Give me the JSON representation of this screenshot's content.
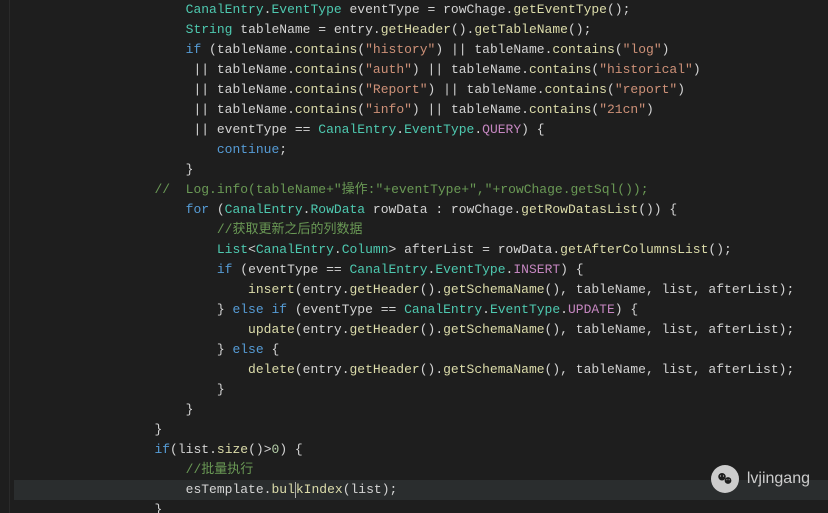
{
  "watermark": {
    "label": "lvjingang"
  },
  "code": {
    "lines": [
      {
        "indent": 3,
        "tokens": [
          {
            "t": "type",
            "v": "CanalEntry"
          },
          {
            "t": "punct",
            "v": "."
          },
          {
            "t": "type",
            "v": "EventType"
          },
          {
            "t": "punct",
            "v": " "
          },
          {
            "t": "var",
            "v": "eventType"
          },
          {
            "t": "punct",
            "v": " = "
          },
          {
            "t": "var",
            "v": "rowChage"
          },
          {
            "t": "punct",
            "v": "."
          },
          {
            "t": "method",
            "v": "getEventType"
          },
          {
            "t": "punct",
            "v": "();"
          }
        ]
      },
      {
        "indent": 3,
        "tokens": [
          {
            "t": "type",
            "v": "String"
          },
          {
            "t": "punct",
            "v": " "
          },
          {
            "t": "var",
            "v": "tableName"
          },
          {
            "t": "punct",
            "v": " = "
          },
          {
            "t": "var",
            "v": "entry"
          },
          {
            "t": "punct",
            "v": "."
          },
          {
            "t": "method",
            "v": "getHeader"
          },
          {
            "t": "punct",
            "v": "()."
          },
          {
            "t": "method",
            "v": "getTableName"
          },
          {
            "t": "punct",
            "v": "();"
          }
        ]
      },
      {
        "indent": 3,
        "tokens": [
          {
            "t": "kw",
            "v": "if"
          },
          {
            "t": "punct",
            "v": " ("
          },
          {
            "t": "var",
            "v": "tableName"
          },
          {
            "t": "punct",
            "v": "."
          },
          {
            "t": "method",
            "v": "contains"
          },
          {
            "t": "punct",
            "v": "("
          },
          {
            "t": "str",
            "v": "\"history\""
          },
          {
            "t": "punct",
            "v": ") || "
          },
          {
            "t": "var",
            "v": "tableName"
          },
          {
            "t": "punct",
            "v": "."
          },
          {
            "t": "method",
            "v": "contains"
          },
          {
            "t": "punct",
            "v": "("
          },
          {
            "t": "str",
            "v": "\"log\""
          },
          {
            "t": "punct",
            "v": ")"
          }
        ]
      },
      {
        "indent": 5,
        "tokens": [
          {
            "t": "punct",
            "v": "|| "
          },
          {
            "t": "var",
            "v": "tableName"
          },
          {
            "t": "punct",
            "v": "."
          },
          {
            "t": "method",
            "v": "contains"
          },
          {
            "t": "punct",
            "v": "("
          },
          {
            "t": "str",
            "v": "\"auth\""
          },
          {
            "t": "punct",
            "v": ") || "
          },
          {
            "t": "var",
            "v": "tableName"
          },
          {
            "t": "punct",
            "v": "."
          },
          {
            "t": "method",
            "v": "contains"
          },
          {
            "t": "punct",
            "v": "("
          },
          {
            "t": "str",
            "v": "\"historical\""
          },
          {
            "t": "punct",
            "v": ")"
          }
        ]
      },
      {
        "indent": 5,
        "tokens": [
          {
            "t": "punct",
            "v": "|| "
          },
          {
            "t": "var",
            "v": "tableName"
          },
          {
            "t": "punct",
            "v": "."
          },
          {
            "t": "method",
            "v": "contains"
          },
          {
            "t": "punct",
            "v": "("
          },
          {
            "t": "str",
            "v": "\"Report\""
          },
          {
            "t": "punct",
            "v": ") || "
          },
          {
            "t": "var",
            "v": "tableName"
          },
          {
            "t": "punct",
            "v": "."
          },
          {
            "t": "method",
            "v": "contains"
          },
          {
            "t": "punct",
            "v": "("
          },
          {
            "t": "str",
            "v": "\"report\""
          },
          {
            "t": "punct",
            "v": ")"
          }
        ]
      },
      {
        "indent": 5,
        "tokens": [
          {
            "t": "punct",
            "v": "|| "
          },
          {
            "t": "var",
            "v": "tableName"
          },
          {
            "t": "punct",
            "v": "."
          },
          {
            "t": "method",
            "v": "contains"
          },
          {
            "t": "punct",
            "v": "("
          },
          {
            "t": "str",
            "v": "\"info\""
          },
          {
            "t": "punct",
            "v": ") || "
          },
          {
            "t": "var",
            "v": "tableName"
          },
          {
            "t": "punct",
            "v": "."
          },
          {
            "t": "method",
            "v": "contains"
          },
          {
            "t": "punct",
            "v": "("
          },
          {
            "t": "str",
            "v": "\"21cn\""
          },
          {
            "t": "punct",
            "v": ")"
          }
        ]
      },
      {
        "indent": 5,
        "tokens": [
          {
            "t": "punct",
            "v": "|| "
          },
          {
            "t": "var",
            "v": "eventType"
          },
          {
            "t": "punct",
            "v": " == "
          },
          {
            "t": "type",
            "v": "CanalEntry"
          },
          {
            "t": "punct",
            "v": "."
          },
          {
            "t": "type",
            "v": "EventType"
          },
          {
            "t": "punct",
            "v": "."
          },
          {
            "t": "const",
            "v": "QUERY"
          },
          {
            "t": "punct",
            "v": ") {"
          }
        ]
      },
      {
        "indent": 4,
        "tokens": [
          {
            "t": "kw",
            "v": "continue"
          },
          {
            "t": "punct",
            "v": ";"
          }
        ]
      },
      {
        "indent": 3,
        "tokens": [
          {
            "t": "punct",
            "v": "}"
          }
        ]
      },
      {
        "indent": 2,
        "tokens": [
          {
            "t": "comment",
            "v": "//  Log.info(tableName+\"操作:\"+eventType+\",\"+rowChage.getSql());"
          }
        ]
      },
      {
        "indent": 3,
        "tokens": [
          {
            "t": "kw",
            "v": "for"
          },
          {
            "t": "punct",
            "v": " ("
          },
          {
            "t": "type",
            "v": "CanalEntry"
          },
          {
            "t": "punct",
            "v": "."
          },
          {
            "t": "type",
            "v": "RowData"
          },
          {
            "t": "punct",
            "v": " "
          },
          {
            "t": "var",
            "v": "rowData"
          },
          {
            "t": "punct",
            "v": " : "
          },
          {
            "t": "var",
            "v": "rowChage"
          },
          {
            "t": "punct",
            "v": "."
          },
          {
            "t": "method",
            "v": "getRowDatasList"
          },
          {
            "t": "punct",
            "v": "()) {"
          }
        ]
      },
      {
        "indent": 4,
        "tokens": [
          {
            "t": "comment",
            "v": "//获取更新之后的列数据"
          }
        ]
      },
      {
        "indent": 4,
        "tokens": [
          {
            "t": "type",
            "v": "List"
          },
          {
            "t": "punct",
            "v": "<"
          },
          {
            "t": "type",
            "v": "CanalEntry"
          },
          {
            "t": "punct",
            "v": "."
          },
          {
            "t": "type",
            "v": "Column"
          },
          {
            "t": "punct",
            "v": "> "
          },
          {
            "t": "var",
            "v": "afterList"
          },
          {
            "t": "punct",
            "v": " = "
          },
          {
            "t": "var",
            "v": "rowData"
          },
          {
            "t": "punct",
            "v": "."
          },
          {
            "t": "method",
            "v": "getAfterColumnsList"
          },
          {
            "t": "punct",
            "v": "();"
          }
        ]
      },
      {
        "indent": 4,
        "tokens": [
          {
            "t": "kw",
            "v": "if"
          },
          {
            "t": "punct",
            "v": " ("
          },
          {
            "t": "var",
            "v": "eventType"
          },
          {
            "t": "punct",
            "v": " == "
          },
          {
            "t": "type",
            "v": "CanalEntry"
          },
          {
            "t": "punct",
            "v": "."
          },
          {
            "t": "type",
            "v": "EventType"
          },
          {
            "t": "punct",
            "v": "."
          },
          {
            "t": "const",
            "v": "INSERT"
          },
          {
            "t": "punct",
            "v": ") {"
          }
        ]
      },
      {
        "indent": 5,
        "tokens": [
          {
            "t": "method",
            "v": "insert"
          },
          {
            "t": "punct",
            "v": "("
          },
          {
            "t": "var",
            "v": "entry"
          },
          {
            "t": "punct",
            "v": "."
          },
          {
            "t": "method",
            "v": "getHeader"
          },
          {
            "t": "punct",
            "v": "()."
          },
          {
            "t": "method",
            "v": "getSchemaName"
          },
          {
            "t": "punct",
            "v": "(), "
          },
          {
            "t": "var",
            "v": "tableName"
          },
          {
            "t": "punct",
            "v": ", "
          },
          {
            "t": "var",
            "v": "list"
          },
          {
            "t": "punct",
            "v": ", "
          },
          {
            "t": "var",
            "v": "afterList"
          },
          {
            "t": "punct",
            "v": ");"
          }
        ]
      },
      {
        "indent": 4,
        "tokens": [
          {
            "t": "punct",
            "v": "} "
          },
          {
            "t": "kw",
            "v": "else if"
          },
          {
            "t": "punct",
            "v": " ("
          },
          {
            "t": "var",
            "v": "eventType"
          },
          {
            "t": "punct",
            "v": " == "
          },
          {
            "t": "type",
            "v": "CanalEntry"
          },
          {
            "t": "punct",
            "v": "."
          },
          {
            "t": "type",
            "v": "EventType"
          },
          {
            "t": "punct",
            "v": "."
          },
          {
            "t": "const",
            "v": "UPDATE"
          },
          {
            "t": "punct",
            "v": ") {"
          }
        ]
      },
      {
        "indent": 5,
        "tokens": [
          {
            "t": "method",
            "v": "update"
          },
          {
            "t": "punct",
            "v": "("
          },
          {
            "t": "var",
            "v": "entry"
          },
          {
            "t": "punct",
            "v": "."
          },
          {
            "t": "method",
            "v": "getHeader"
          },
          {
            "t": "punct",
            "v": "()."
          },
          {
            "t": "method",
            "v": "getSchemaName"
          },
          {
            "t": "punct",
            "v": "(), "
          },
          {
            "t": "var",
            "v": "tableName"
          },
          {
            "t": "punct",
            "v": ", "
          },
          {
            "t": "var",
            "v": "list"
          },
          {
            "t": "punct",
            "v": ", "
          },
          {
            "t": "var",
            "v": "afterList"
          },
          {
            "t": "punct",
            "v": ");"
          }
        ]
      },
      {
        "indent": 4,
        "tokens": [
          {
            "t": "punct",
            "v": "} "
          },
          {
            "t": "kw",
            "v": "else"
          },
          {
            "t": "punct",
            "v": " {"
          }
        ]
      },
      {
        "indent": 5,
        "tokens": [
          {
            "t": "method",
            "v": "delete"
          },
          {
            "t": "punct",
            "v": "("
          },
          {
            "t": "var",
            "v": "entry"
          },
          {
            "t": "punct",
            "v": "."
          },
          {
            "t": "method",
            "v": "getHeader"
          },
          {
            "t": "punct",
            "v": "()."
          },
          {
            "t": "method",
            "v": "getSchemaName"
          },
          {
            "t": "punct",
            "v": "(), "
          },
          {
            "t": "var",
            "v": "tableName"
          },
          {
            "t": "punct",
            "v": ", "
          },
          {
            "t": "var",
            "v": "list"
          },
          {
            "t": "punct",
            "v": ", "
          },
          {
            "t": "var",
            "v": "afterList"
          },
          {
            "t": "punct",
            "v": ");"
          }
        ]
      },
      {
        "indent": 4,
        "tokens": [
          {
            "t": "punct",
            "v": "}"
          }
        ]
      },
      {
        "indent": 3,
        "tokens": [
          {
            "t": "punct",
            "v": "}"
          }
        ]
      },
      {
        "indent": 2,
        "tokens": [
          {
            "t": "punct",
            "v": "}"
          }
        ]
      },
      {
        "indent": 2,
        "tokens": [
          {
            "t": "kw",
            "v": "if"
          },
          {
            "t": "punct",
            "v": "("
          },
          {
            "t": "var",
            "v": "list"
          },
          {
            "t": "punct",
            "v": "."
          },
          {
            "t": "method",
            "v": "size"
          },
          {
            "t": "punct",
            "v": "()>"
          },
          {
            "t": "num",
            "v": "0"
          },
          {
            "t": "punct",
            "v": ") {"
          }
        ]
      },
      {
        "indent": 3,
        "tokens": [
          {
            "t": "comment",
            "v": "//批量执行"
          }
        ]
      },
      {
        "indent": 3,
        "hl": true,
        "tokens": [
          {
            "t": "var",
            "v": "esTemplate"
          },
          {
            "t": "punct",
            "v": "."
          },
          {
            "t": "method",
            "v": "bul"
          },
          {
            "t": "cursor",
            "v": ""
          },
          {
            "t": "method",
            "v": "kIndex"
          },
          {
            "t": "punct",
            "v": "("
          },
          {
            "t": "var",
            "v": "list"
          },
          {
            "t": "punct",
            "v": ");"
          }
        ]
      },
      {
        "indent": 2,
        "tokens": [
          {
            "t": "punct",
            "v": "}"
          }
        ]
      }
    ]
  }
}
